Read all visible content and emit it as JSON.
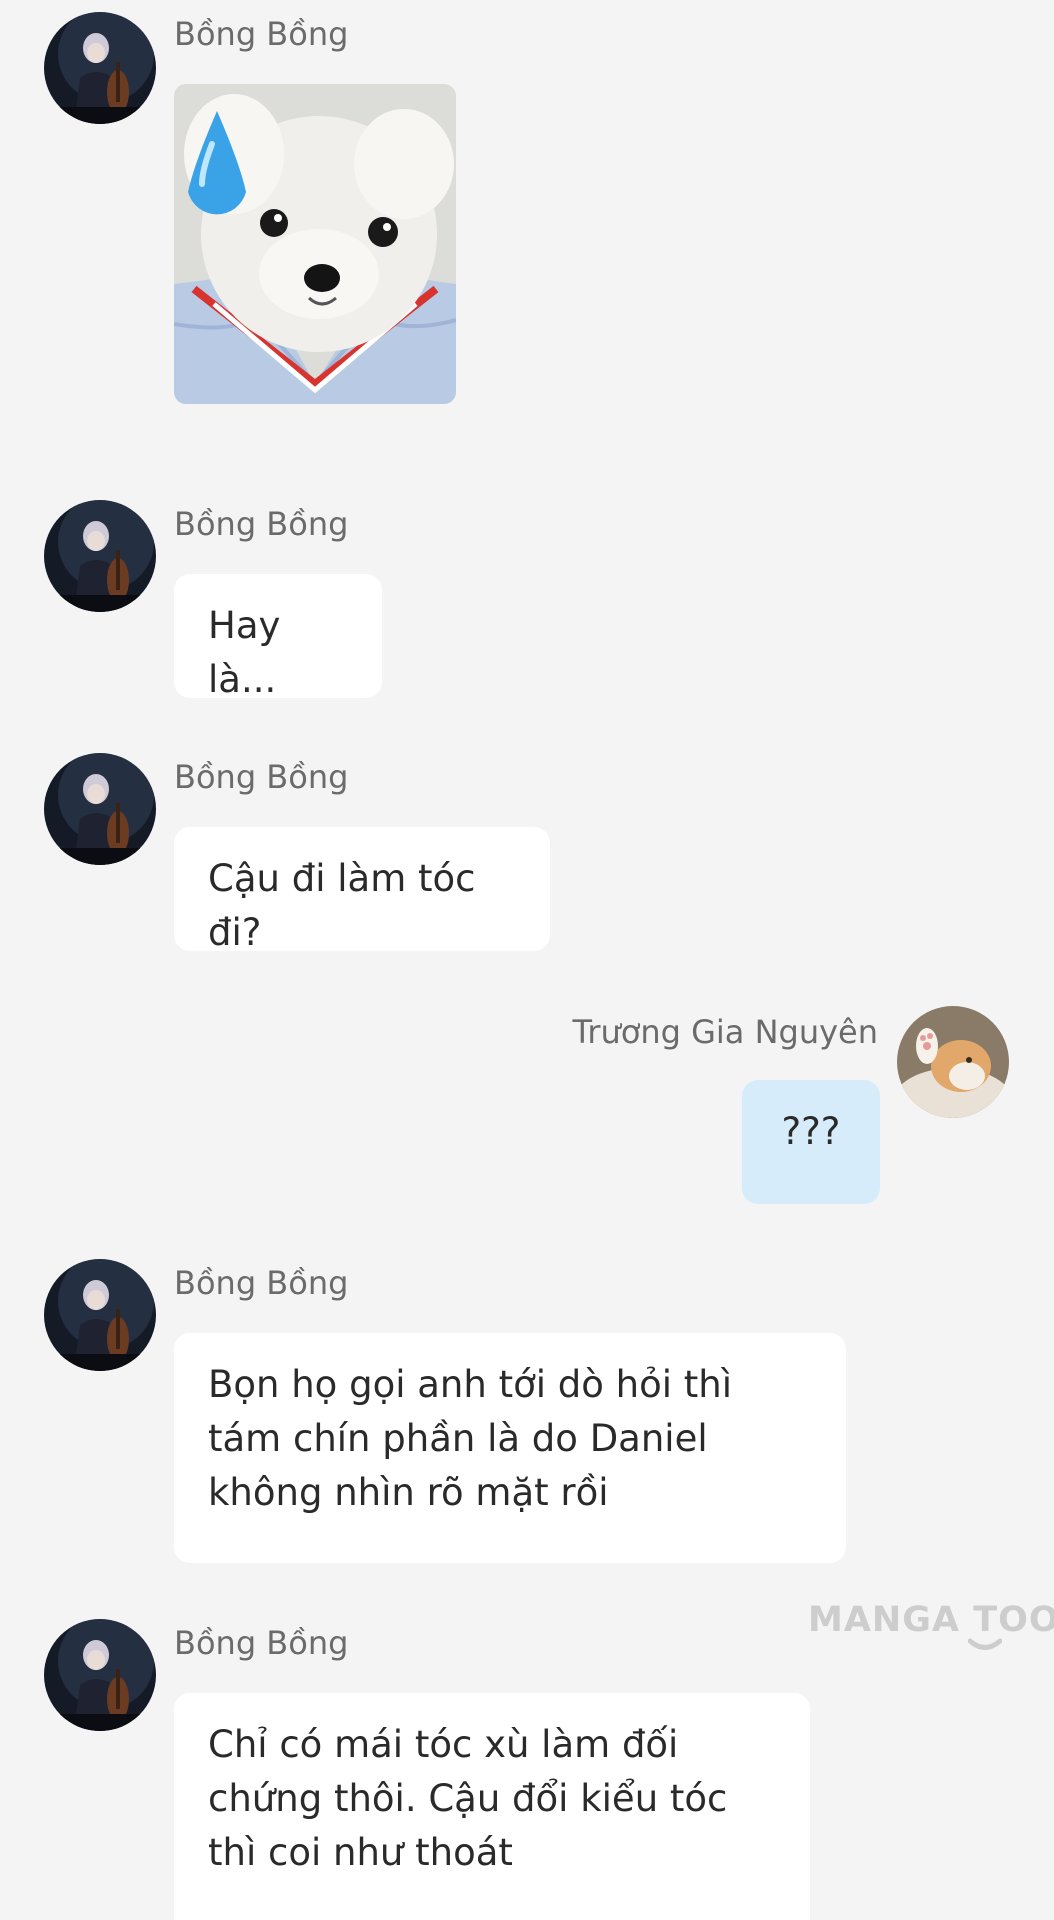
{
  "messages": [
    {
      "sender": "Bồng Bồng",
      "type": "sticker",
      "sticker_icon": "puppy-sweat-sticker"
    },
    {
      "sender": "Bồng Bồng",
      "type": "text",
      "text": "Hay là..."
    },
    {
      "sender": "Bồng Bồng",
      "type": "text",
      "text": "Cậu đi làm tóc đi?"
    },
    {
      "sender": "Trương Gia Nguyên",
      "type": "text",
      "text": "???"
    },
    {
      "sender": "Bồng Bồng",
      "type": "text",
      "text": "Bọn họ gọi anh tới dò hỏi thì tám chín phần là do Daniel không nhìn rõ mặt rồi"
    },
    {
      "sender": "Bồng Bồng",
      "type": "text",
      "text": "Chỉ có mái tóc xù làm đối chứng thôi. Cậu đổi kiểu tóc thì coi như thoát"
    }
  ],
  "watermark": "MANGA TOON",
  "colors": {
    "background": "#f4f4f4",
    "bubble_other": "#ffffff",
    "bubble_self": "#d6ecfb",
    "sender_name": "#6b6b6b"
  }
}
